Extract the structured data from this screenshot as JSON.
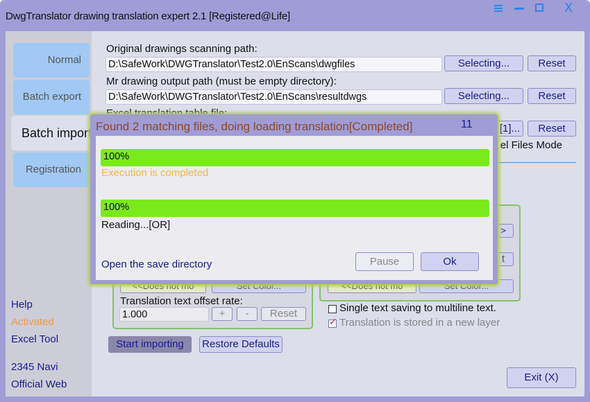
{
  "window": {
    "title": "DwgTranslator drawing translation expert 2.1 [Registered@Life]",
    "controls": [
      "menu-icon",
      "minimize-icon",
      "maximize-icon",
      "close-icon"
    ],
    "close_glyph": "X"
  },
  "sidebar": {
    "tabs": [
      {
        "label": "Normal",
        "active": false
      },
      {
        "label": "Batch export",
        "active": false
      },
      {
        "label": "Batch import",
        "active": true
      },
      {
        "label": "Registration",
        "active": false
      }
    ],
    "links": [
      {
        "label": "Help"
      },
      {
        "label": "Activated"
      },
      {
        "label": "Excel Tool"
      },
      {
        "label": "2345 Navi"
      },
      {
        "label": "Official Web"
      }
    ]
  },
  "main": {
    "scan_path": {
      "label": "Original drawings scanning path:",
      "value": "D:\\SafeWork\\DWGTranslator\\Test2.0\\EnScans\\dwgfiles",
      "select_label": "Selecting...",
      "reset_label": "Reset"
    },
    "output_path": {
      "label": "Mr drawing output path (must be empty directory):",
      "value": "D:\\SafeWork\\DWGTranslator\\Test2.0\\EnScans\\resultdwgs",
      "select_label": "Selecting...",
      "reset_label": "Reset"
    },
    "excel_file": {
      "label": "Excel translation table file:",
      "select_label_partial": "[1]...",
      "reset_label": "Reset",
      "mode_partial": "el Files Mode"
    },
    "left_group": {
      "color_source_partial": "<<Does not mo",
      "set_color_partial": "Set Color...",
      "offset_label": "Translation text offset rate:",
      "offset_value": "1.000",
      "plus_label": "+",
      "minus_label": "-",
      "reset_label": "Reset"
    },
    "right_group": {
      "color_source_partial": "<<Does not mo",
      "set_color_partial": "Set Color...",
      "hidden_btn1_partial": ">",
      "hidden_btn2_partial": "t"
    },
    "options": {
      "multiline": {
        "label": "Single text saving to multiline text.",
        "checked": false
      },
      "new_layer": {
        "label": "Translation is stored in a new layer",
        "checked": true
      }
    },
    "start_label": "Start importing",
    "restore_label": "Restore Defaults",
    "exit_label": "Exit (X)"
  },
  "dialog": {
    "title": "Found 2 matching files, doing loading translation[Completed]",
    "count": "11",
    "progress1": {
      "percent": 100,
      "text": "100%",
      "status": "Execution is completed"
    },
    "progress2": {
      "percent": 100,
      "text": "100%",
      "status": "Reading...[OR]"
    },
    "open_dir_label": "Open the save directory",
    "pause_label": "Pause",
    "ok_label": "Ok"
  },
  "colors": {
    "window_frame": "#a09cd6",
    "progress_fill": "#7aea1a",
    "link": "#1a1a8c",
    "activated": "#f09a3e",
    "completed_status": "#f0b840",
    "dialog_title": "#8a4a2a",
    "dialog_glow": "#b4d04a"
  }
}
